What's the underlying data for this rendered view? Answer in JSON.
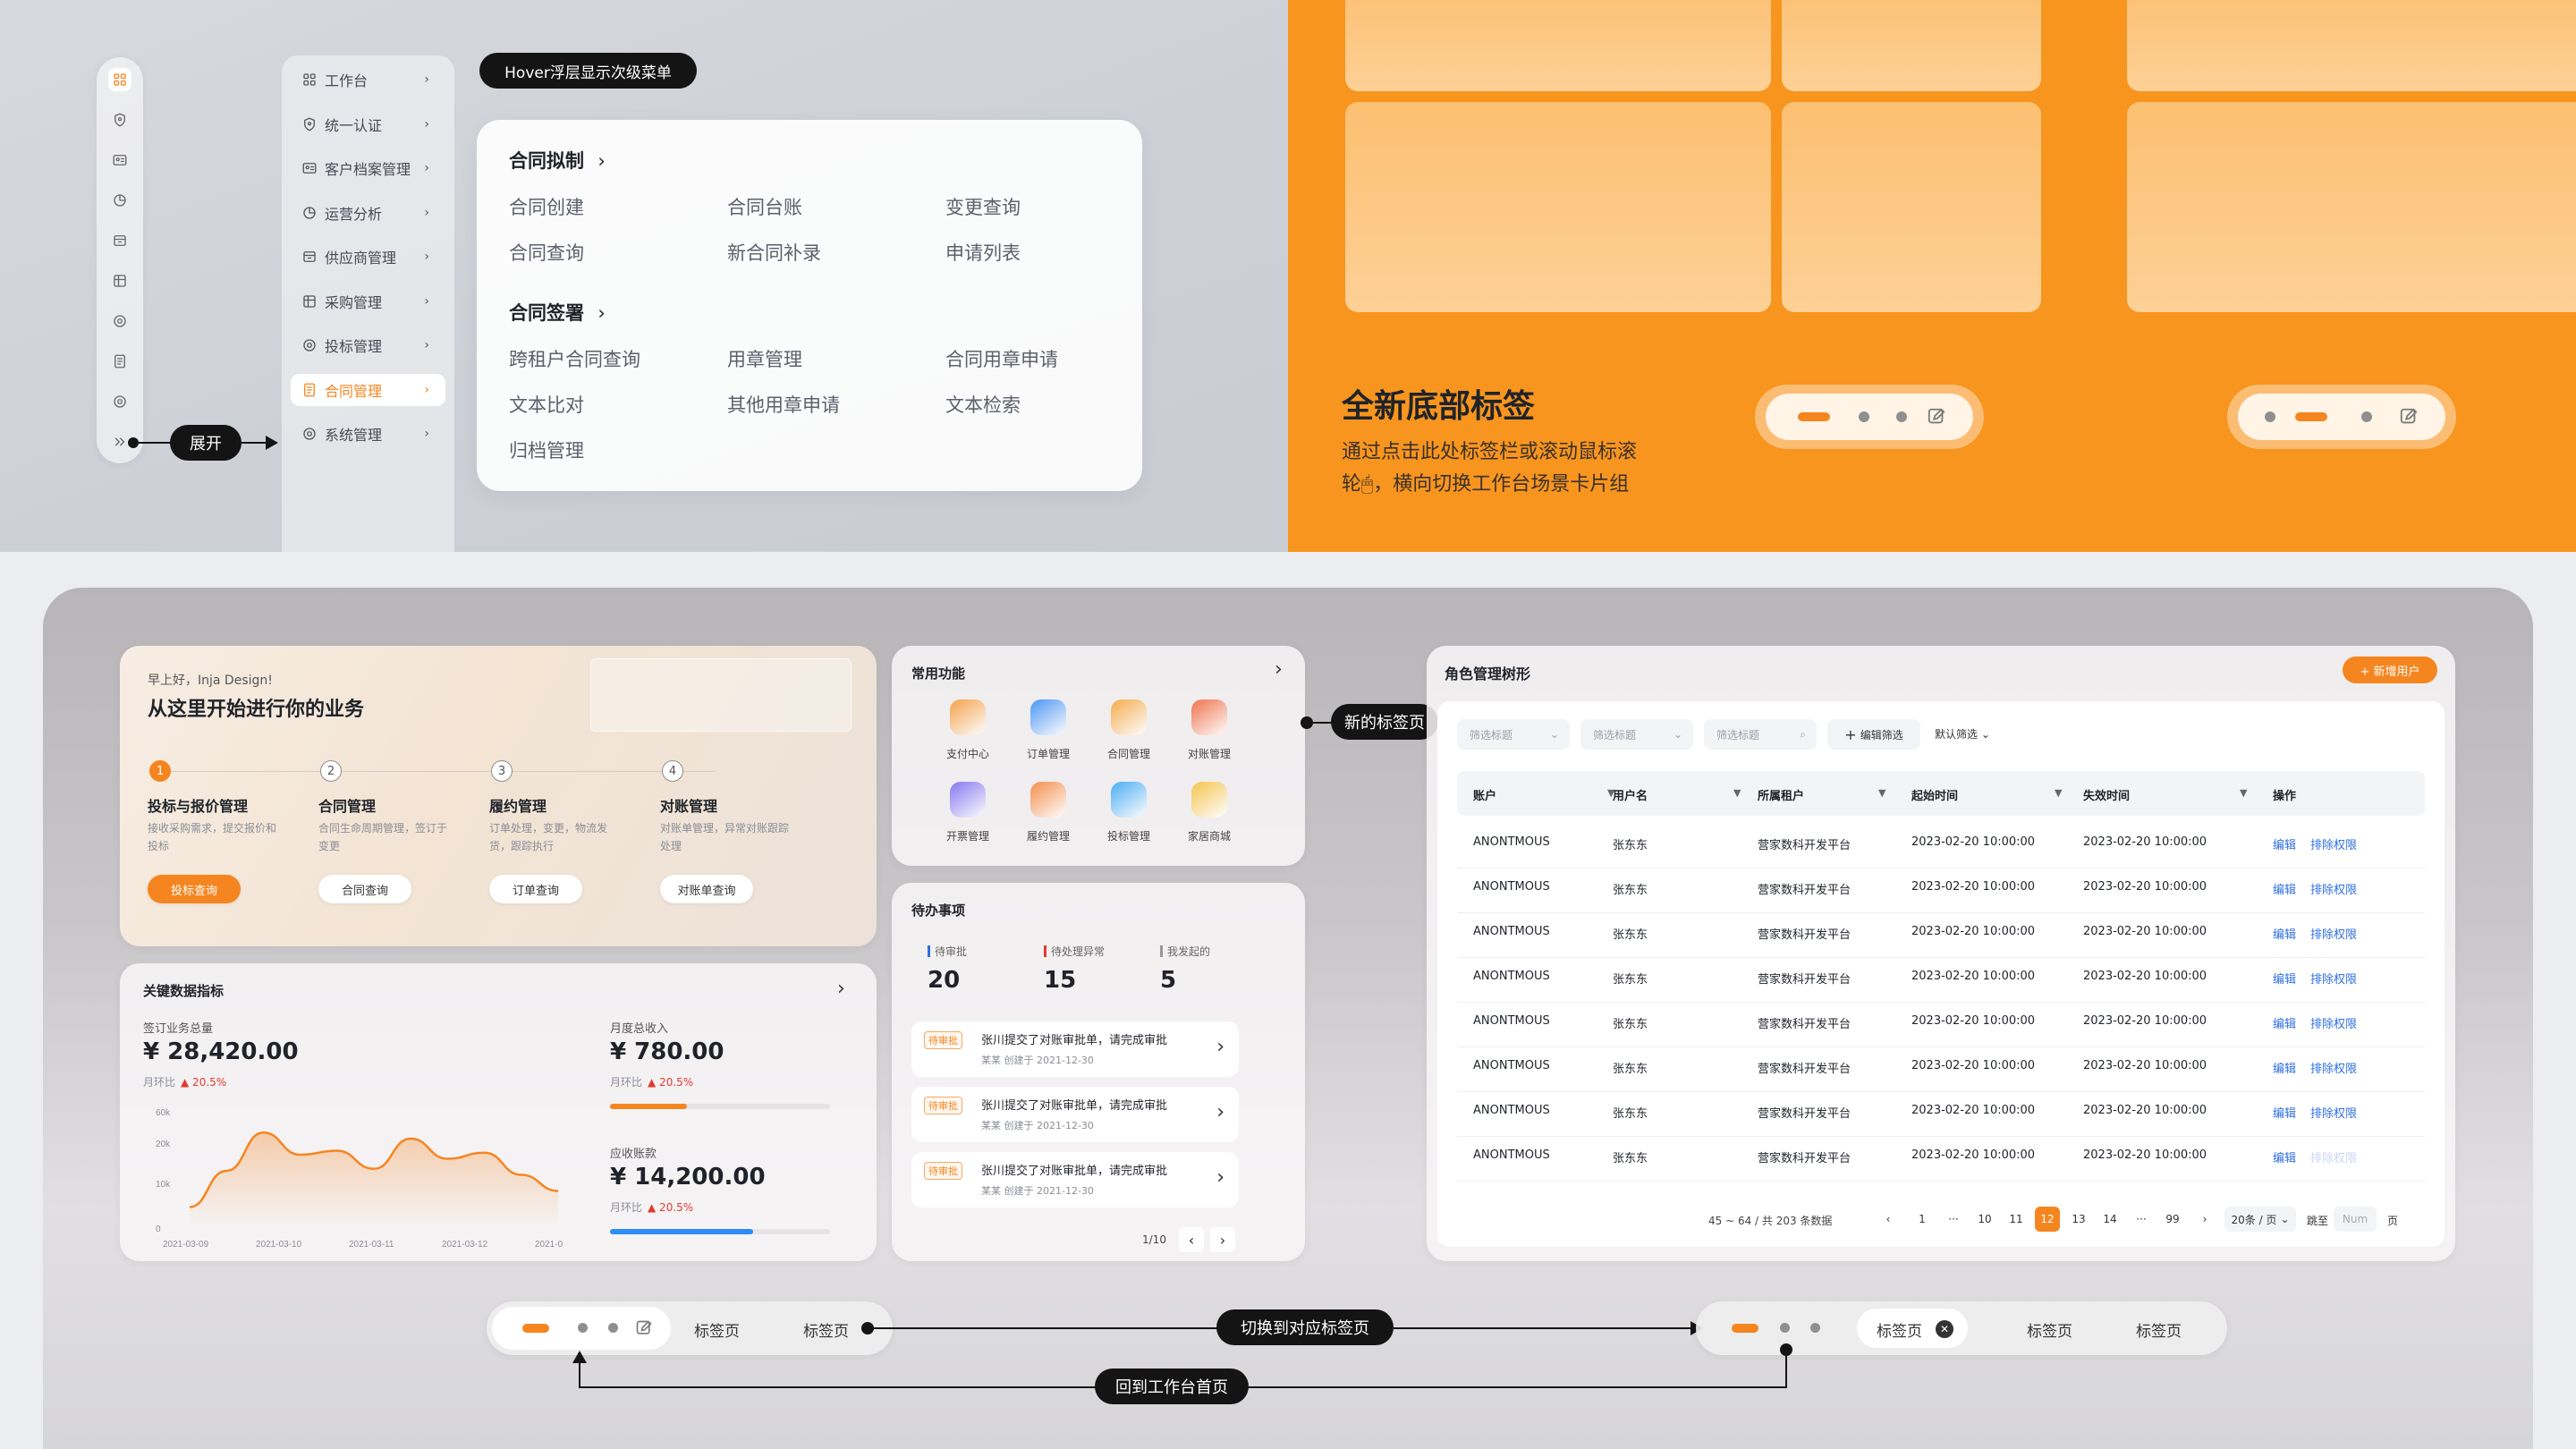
{
  "colors": {
    "accent": "#f5851f",
    "dark": "#141414",
    "link": "#2f6fe0",
    "up": "#e5382e"
  },
  "labels": {
    "hover_tip": "Hover浮层显示次级菜单",
    "expand": "展开",
    "new_tab": "新的标签页",
    "switch_tab": "切换到对应标签页",
    "back_home": "回到工作台首页"
  },
  "rail_icons": [
    "apps-icon",
    "shield-icon",
    "id-card-icon",
    "chart-pie-icon",
    "box-icon",
    "store-icon",
    "target-icon",
    "document-icon",
    "gear-icon",
    "double-chevron-icon"
  ],
  "side_menu": [
    {
      "label": "工作台",
      "icon": "apps-icon"
    },
    {
      "label": "统一认证",
      "icon": "shield-icon"
    },
    {
      "label": "客户档案管理",
      "icon": "id-card-icon"
    },
    {
      "label": "运营分析",
      "icon": "chart-pie-icon"
    },
    {
      "label": "供应商管理",
      "icon": "box-icon"
    },
    {
      "label": "采购管理",
      "icon": "store-icon"
    },
    {
      "label": "投标管理",
      "icon": "target-icon"
    },
    {
      "label": "合同管理",
      "icon": "document-icon",
      "active": true
    },
    {
      "label": "系统管理",
      "icon": "gear-icon"
    }
  ],
  "submenu": {
    "group1": {
      "title": "合同拟制",
      "items": [
        "合同创建",
        "合同台账",
        "变更查询",
        "合同查询",
        "新合同补录",
        "申请列表"
      ]
    },
    "group2": {
      "title": "合同签署",
      "items": [
        "跨租户合同查询",
        "用章管理",
        "合同用章申请",
        "文本比对",
        "其他用章申请",
        "文本检索",
        "归档管理"
      ]
    }
  },
  "orange": {
    "title": "全新底部标签",
    "desc1": "通过点击此处标签栏或滚动鼠标滚",
    "desc2": "轮🖱，横向切换工作台场景卡片组"
  },
  "welcome": {
    "greeting": "早上好，Inja Design!",
    "headline": "从这里开始进行你的业务",
    "steps": [
      {
        "num": "1",
        "title": "投标与报价管理",
        "desc": "接收采购需求，提交报价和投标",
        "btn": "投标查询",
        "active": true
      },
      {
        "num": "2",
        "title": "合同管理",
        "desc": "合同生命周期管理，签订于变更",
        "btn": "合同查询"
      },
      {
        "num": "3",
        "title": "履约管理",
        "desc": "订单处理，变更，物流发货，跟踪执行",
        "btn": "订单查询"
      },
      {
        "num": "4",
        "title": "对账管理",
        "desc": "对账单管理，异常对账跟踪处理",
        "btn": "对账单查询"
      }
    ]
  },
  "kpi": {
    "title": "关键数据指标",
    "left": {
      "label": "签订业务总量",
      "value": "¥ 28,420.00",
      "mom": "月环比",
      "change": "▲ 20.5%"
    },
    "right1": {
      "label": "月度总收入",
      "value": "¥ 780.00",
      "mom": "月环比",
      "change": "▲ 20.5%",
      "progress": 0.35
    },
    "right2": {
      "label": "应收账款",
      "value": "¥ 14,200.00",
      "mom": "月环比",
      "change": "▲ 20.5%",
      "progress": 0.65
    }
  },
  "chart_data": {
    "type": "area",
    "x": [
      "2021-03-09",
      "2021-03-10",
      "2021-03-11",
      "2021-03-12",
      "2021-0"
    ],
    "y_ticks": [
      "60k",
      "20k",
      "10k",
      "0"
    ],
    "series": [
      {
        "values": [
          10,
          28,
          47,
          36,
          38,
          29,
          44,
          34,
          37,
          26,
          18
        ]
      }
    ],
    "ylim": [
      0,
      60
    ]
  },
  "common": {
    "title": "常用功能",
    "apps": [
      {
        "label": "支付中心",
        "color": "#f59a3a"
      },
      {
        "label": "订单管理",
        "color": "#3a8df5"
      },
      {
        "label": "合同管理",
        "color": "#f5a53a"
      },
      {
        "label": "对账管理",
        "color": "#f0653a"
      },
      {
        "label": "开票管理",
        "color": "#7a6af0"
      },
      {
        "label": "履约管理",
        "color": "#f5843a"
      },
      {
        "label": "投标管理",
        "color": "#3aa6f5"
      },
      {
        "label": "家居商城",
        "color": "#f5c03a"
      }
    ]
  },
  "todo": {
    "title": "待办事项",
    "stats": [
      {
        "label": "待审批",
        "value": "20",
        "color": "#2f6fe0"
      },
      {
        "label": "待处理异常",
        "value": "15",
        "color": "#e5382e"
      },
      {
        "label": "我发起的",
        "value": "5",
        "color": "#999999"
      }
    ],
    "items": [
      {
        "tag": "待审批",
        "title": "张川提交了对账审批单，请完成审批",
        "sub": "某某 创建于 2021-12-30"
      },
      {
        "tag": "待审批",
        "title": "张川提交了对账审批单，请完成审批",
        "sub": "某某 创建于 2021-12-30"
      },
      {
        "tag": "待审批",
        "title": "张川提交了对账审批单，请完成审批",
        "sub": "某某 创建于 2021-12-30"
      }
    ],
    "page": "1/10"
  },
  "role": {
    "title": "角色管理树形",
    "add_btn": "+ 新增用户",
    "filters": [
      "筛选标题",
      "筛选标题",
      "筛选标题"
    ],
    "edit_filter": "编辑筛选",
    "default_filter": "默认筛选",
    "columns": [
      "账户",
      "用户名",
      "所属租户",
      "起始时间",
      "失效时间",
      "操作"
    ],
    "rows": [
      {
        "account": "ANONTMOUS",
        "user": "张东东",
        "tenant": "营家数科开发平台",
        "start": "2023-02-20 10:00:00",
        "end": "2023-02-20 10:00:00",
        "edit": "编辑",
        "perm": "排除权限"
      },
      {
        "account": "ANONTMOUS",
        "user": "张东东",
        "tenant": "营家数科开发平台",
        "start": "2023-02-20 10:00:00",
        "end": "2023-02-20 10:00:00",
        "edit": "编辑",
        "perm": "排除权限"
      },
      {
        "account": "ANONTMOUS",
        "user": "张东东",
        "tenant": "营家数科开发平台",
        "start": "2023-02-20 10:00:00",
        "end": "2023-02-20 10:00:00",
        "edit": "编辑",
        "perm": "排除权限"
      },
      {
        "account": "ANONTMOUS",
        "user": "张东东",
        "tenant": "营家数科开发平台",
        "start": "2023-02-20 10:00:00",
        "end": "2023-02-20 10:00:00",
        "edit": "编辑",
        "perm": "排除权限"
      },
      {
        "account": "ANONTMOUS",
        "user": "张东东",
        "tenant": "营家数科开发平台",
        "start": "2023-02-20 10:00:00",
        "end": "2023-02-20 10:00:00",
        "edit": "编辑",
        "perm": "排除权限"
      },
      {
        "account": "ANONTMOUS",
        "user": "张东东",
        "tenant": "营家数科开发平台",
        "start": "2023-02-20 10:00:00",
        "end": "2023-02-20 10:00:00",
        "edit": "编辑",
        "perm": "排除权限"
      },
      {
        "account": "ANONTMOUS",
        "user": "张东东",
        "tenant": "营家数科开发平台",
        "start": "2023-02-20 10:00:00",
        "end": "2023-02-20 10:00:00",
        "edit": "编辑",
        "perm": "排除权限"
      },
      {
        "account": "ANONTMOUS",
        "user": "张东东",
        "tenant": "营家数科开发平台",
        "start": "2023-02-20 10:00:00",
        "end": "2023-02-20 10:00:00",
        "edit": "编辑",
        "perm": "排除权限",
        "disabled": true
      }
    ],
    "pagination": {
      "summary": "45 ~ 64 / 共 203 条数据",
      "pages": [
        "1",
        "···",
        "10",
        "11",
        "12",
        "13",
        "14",
        "···",
        "99"
      ],
      "active": "12",
      "size": "20条 / 页",
      "jump": "跳至",
      "num": "Num",
      "page_unit": "页"
    }
  },
  "tabbar": {
    "tab": "标签页"
  }
}
